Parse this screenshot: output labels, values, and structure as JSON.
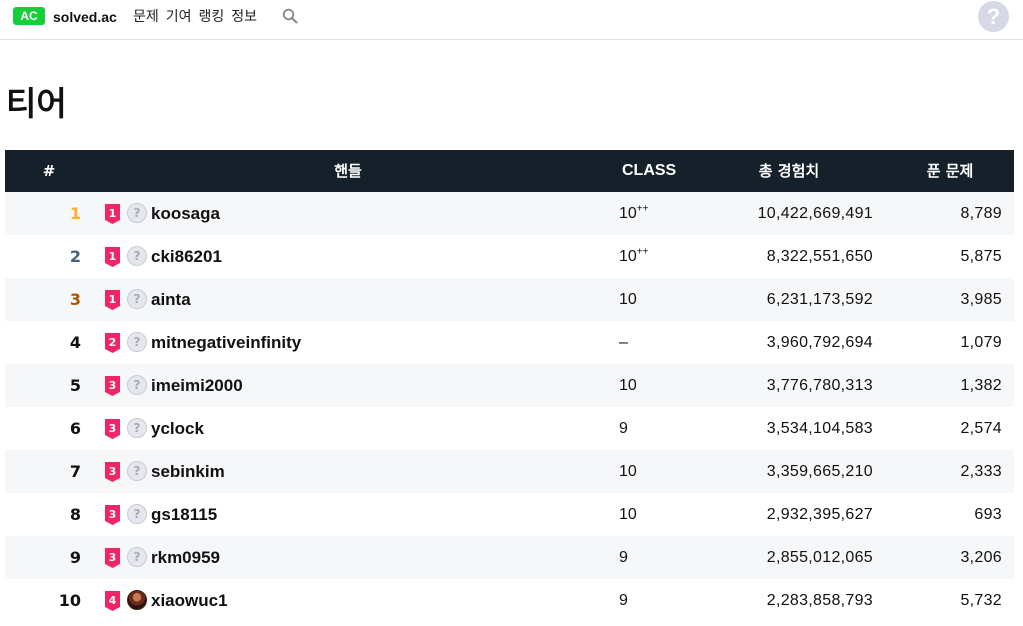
{
  "header": {
    "badge": "AC",
    "brand": "solved.ac",
    "nav": [
      "문제",
      "기여",
      "랭킹",
      "정보"
    ],
    "search_icon": "search-icon",
    "help_label": "?"
  },
  "page": {
    "title": "티어"
  },
  "table": {
    "columns": {
      "rank": "#",
      "handle": "핸들",
      "class": "CLASS",
      "exp": "총 경험치",
      "solved": "푼 문제"
    },
    "rank_colors": {
      "1": "#ffb028",
      "2": "#435f7a",
      "3": "#ad5600",
      "default": "#111111"
    },
    "tier_color": "#ef2566",
    "rows": [
      {
        "rank": "1",
        "tier": "1",
        "handle": "koosaga",
        "class": "10",
        "class_sup": "++",
        "exp": "10,422,669,491",
        "solved": "8,789",
        "avatar": "default"
      },
      {
        "rank": "2",
        "tier": "1",
        "handle": "cki86201",
        "class": "10",
        "class_sup": "++",
        "exp": "8,322,551,650",
        "solved": "5,875",
        "avatar": "default"
      },
      {
        "rank": "3",
        "tier": "1",
        "handle": "ainta",
        "class": "10",
        "class_sup": "",
        "exp": "6,231,173,592",
        "solved": "3,985",
        "avatar": "default"
      },
      {
        "rank": "4",
        "tier": "2",
        "handle": "mitnegativeinfinity",
        "class": "–",
        "class_sup": "",
        "exp": "3,960,792,694",
        "solved": "1,079",
        "avatar": "default"
      },
      {
        "rank": "5",
        "tier": "3",
        "handle": "imeimi2000",
        "class": "10",
        "class_sup": "",
        "exp": "3,776,780,313",
        "solved": "1,382",
        "avatar": "default"
      },
      {
        "rank": "6",
        "tier": "3",
        "handle": "yclock",
        "class": "9",
        "class_sup": "",
        "exp": "3,534,104,583",
        "solved": "2,574",
        "avatar": "default"
      },
      {
        "rank": "7",
        "tier": "3",
        "handle": "sebinkim",
        "class": "10",
        "class_sup": "",
        "exp": "3,359,665,210",
        "solved": "2,333",
        "avatar": "default"
      },
      {
        "rank": "8",
        "tier": "3",
        "handle": "gs18115",
        "class": "10",
        "class_sup": "",
        "exp": "2,932,395,627",
        "solved": "693",
        "avatar": "default"
      },
      {
        "rank": "9",
        "tier": "3",
        "handle": "rkm0959",
        "class": "9",
        "class_sup": "",
        "exp": "2,855,012,065",
        "solved": "3,206",
        "avatar": "default"
      },
      {
        "rank": "10",
        "tier": "4",
        "handle": "xiaowuc1",
        "class": "9",
        "class_sup": "",
        "exp": "2,283,858,793",
        "solved": "5,732",
        "avatar": "photo"
      }
    ]
  }
}
